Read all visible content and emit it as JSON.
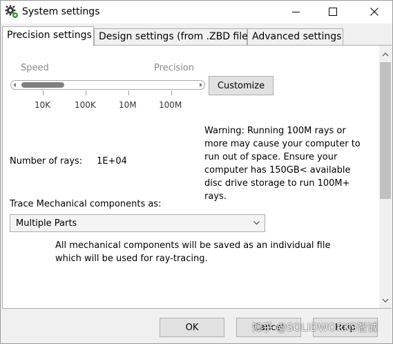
{
  "window": {
    "title": "System settings",
    "icon": "gear-icon"
  },
  "tabs": [
    {
      "label": "Precision settings",
      "active": true
    },
    {
      "label": "Design settings (from .ZBD file)",
      "active": false
    },
    {
      "label": "Advanced settings",
      "active": false
    }
  ],
  "precision": {
    "slider": {
      "left_label": "Speed",
      "right_label": "Precision",
      "ticks": [
        "10K",
        "100K",
        "10M",
        "100M"
      ],
      "value_fraction": 0.0
    },
    "customize_label": "Customize",
    "warning": "Warning: Running 100M rays or more may cause your computer to run out of space. Ensure your computer has 150GB< available disc drive storage to run 100M+ rays.",
    "rays_label": "Number of rays:",
    "rays_value": "1E+04",
    "trace_label": "Trace Mechanical components as:",
    "trace_value": "Multiple Parts",
    "trace_note": "All mechanical components will be saved as an individual file which will be used for ray-tracing."
  },
  "footer": {
    "ok_label": "OK",
    "cancel_label": "Cancel",
    "help_label": "Help"
  },
  "watermark": "知乎 @SOLIDWORKS智诚"
}
